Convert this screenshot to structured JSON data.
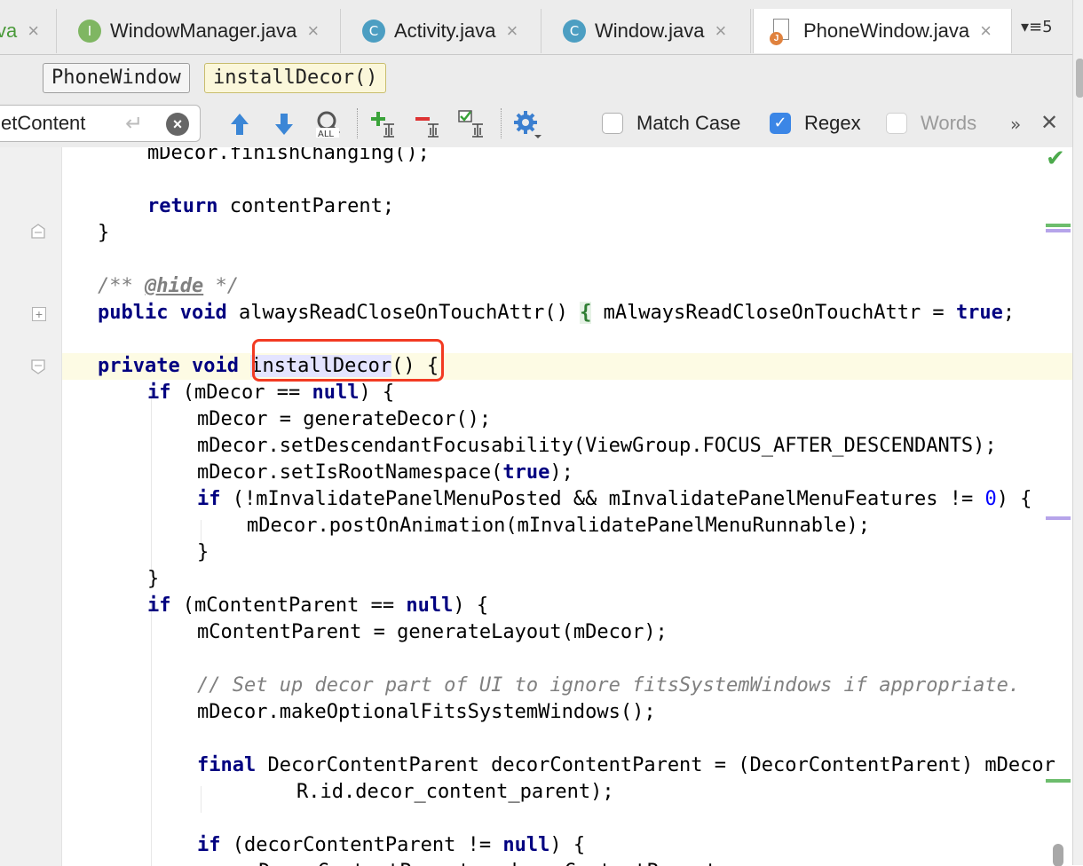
{
  "tabs": [
    {
      "label": "va",
      "icon": "",
      "active": false
    },
    {
      "label": "WindowManager.java",
      "icon": "I",
      "active": false
    },
    {
      "label": "Activity.java",
      "icon": "C",
      "active": false
    },
    {
      "label": "Window.java",
      "icon": "C",
      "active": false
    },
    {
      "label": "PhoneWindow.java",
      "icon": "J",
      "active": true
    }
  ],
  "tab_close": "×",
  "tab_overflow": "▾≡5",
  "breadcrumb": {
    "class_name": "PhoneWindow",
    "method_name": "installDecor()"
  },
  "search": {
    "value": "etContent",
    "match_case": {
      "label": "Match Case",
      "checked": false
    },
    "regex": {
      "label": "Regex",
      "checked": true
    },
    "words": {
      "label": "Words",
      "checked": false,
      "enabled": false
    },
    "more": "»",
    "close": "✕"
  },
  "colors": {
    "keyword": "#000080",
    "comment": "#808080",
    "number": "#0000ff",
    "highlight_box": "#f23a22",
    "line_highlight": "#fdfbe4"
  },
  "code": {
    "l1": "mDecor.finishChanging();",
    "l3_kw": "return",
    "l3_rest": " contentParent;",
    "l4": "}",
    "l6_a": "/** ",
    "l6_tag": "@hide",
    "l6_b": " */",
    "l7_kw1": "public",
    "l7_kw2": "void",
    "l7_a": " alwaysReadCloseOnTouchAttr() ",
    "l7_brace": "{",
    "l7_b": " mAlwaysReadCloseOnTouchAttr = ",
    "l7_true": "true",
    "l7_c": ";",
    "l9_kw1": "private",
    "l9_kw2": "void",
    "l9_name": "installDecor",
    "l9_rest": "() {",
    "l10_kw": "if",
    "l10_a": " (mDecor == ",
    "l10_null": "null",
    "l10_b": ") {",
    "l11": "mDecor = generateDecor();",
    "l12": "mDecor.setDescendantFocusability(ViewGroup.FOCUS_AFTER_DESCENDANTS);",
    "l13_a": "mDecor.setIsRootNamespace(",
    "l13_true": "true",
    "l13_b": ");",
    "l14_kw": "if",
    "l14_a": " (!mInvalidatePanelMenuPosted && mInvalidatePanelMenuFeatures != ",
    "l14_num": "0",
    "l14_b": ") {",
    "l15": "mDecor.postOnAnimation(mInvalidatePanelMenuRunnable);",
    "l16": "}",
    "l17": "}",
    "l18_kw": "if",
    "l18_a": " (mContentParent == ",
    "l18_null": "null",
    "l18_b": ") {",
    "l19": "mContentParent = generateLayout(mDecor);",
    "l21": "// Set up decor part of UI to ignore fitsSystemWindows if appropriate.",
    "l22": "mDecor.makeOptionalFitsSystemWindows();",
    "l24_kw": "final",
    "l24_rest": " DecorContentParent decorContentParent = (DecorContentParent) mDecor",
    "l25": "R.id.decor_content_parent);",
    "l27_kw": "if",
    "l27_a": " (decorContentParent != ",
    "l27_null": "null",
    "l27_b": ") {",
    "l28": "mDecorContentParent = decorContentParent;"
  }
}
